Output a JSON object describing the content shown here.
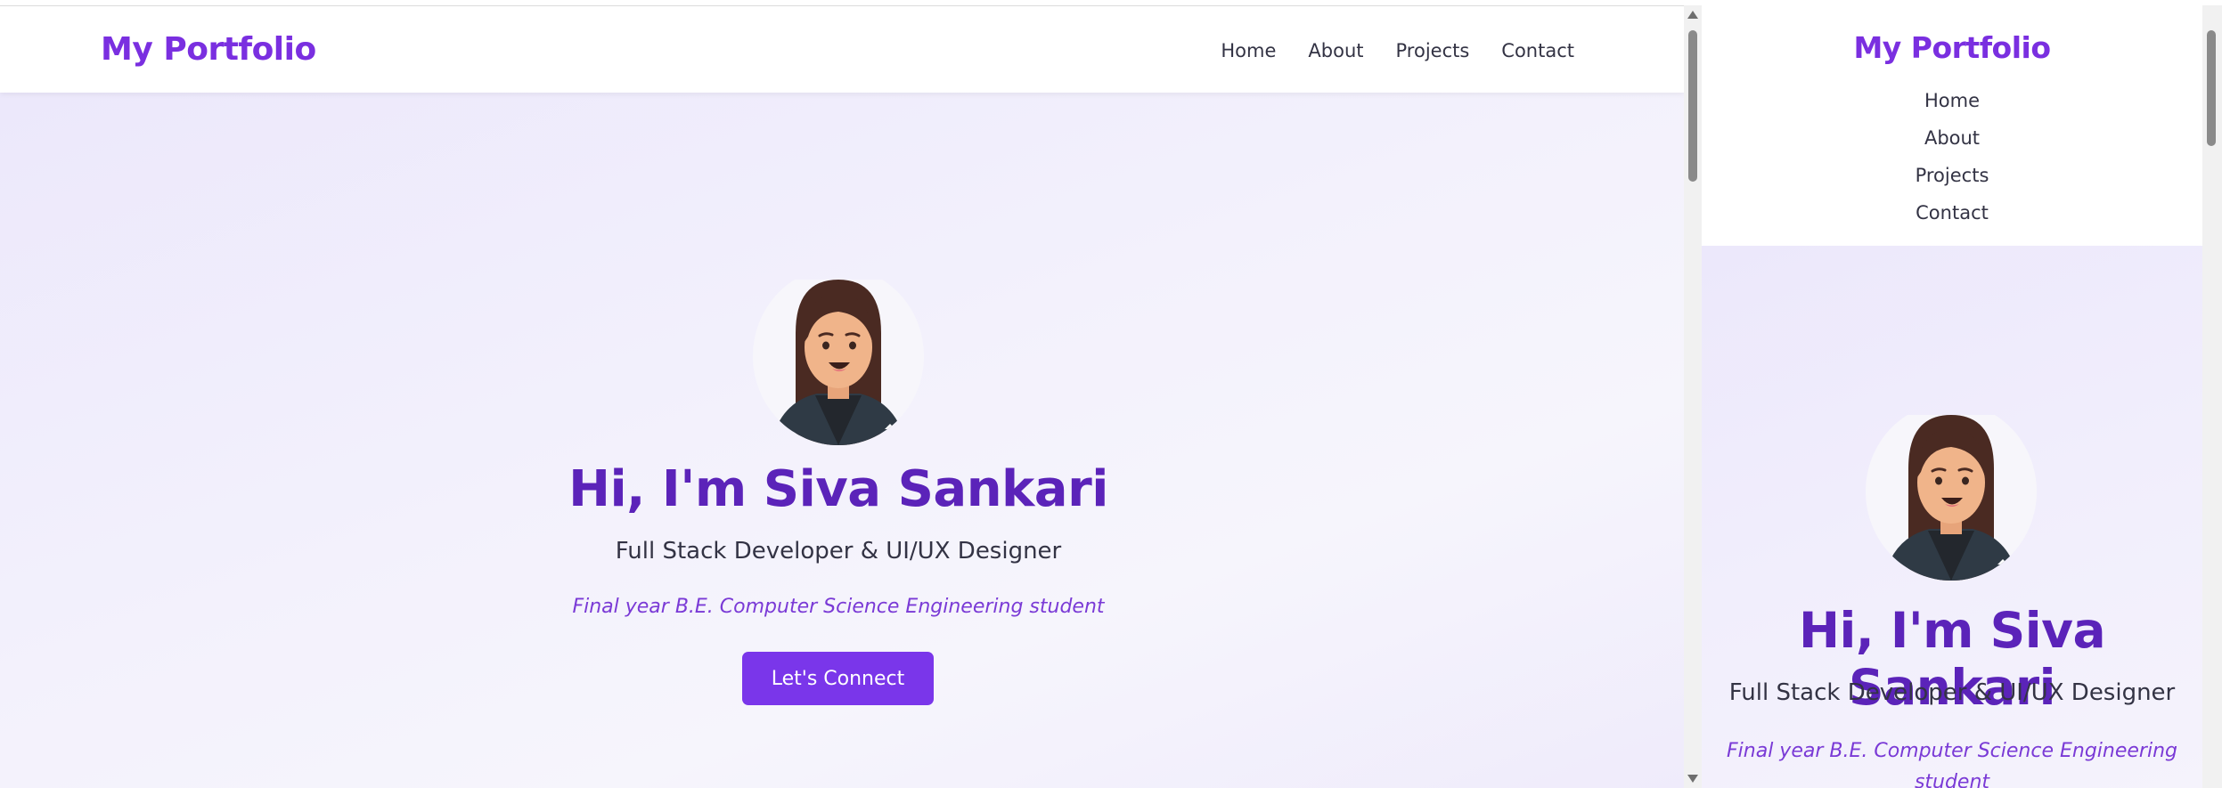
{
  "desktop": {
    "logo": "My Portfolio",
    "nav": [
      {
        "label": "Home"
      },
      {
        "label": "About"
      },
      {
        "label": "Projects"
      },
      {
        "label": "Contact"
      }
    ],
    "hero": {
      "title": "Hi, I'm Siva Sankari",
      "role": "Full Stack Developer & UI/UX Designer",
      "note": "Final year B.E. Computer Science Engineering student",
      "cta_label": "Let's Connect"
    }
  },
  "mobile": {
    "logo": "My Portfolio",
    "nav": [
      {
        "label": "Home"
      },
      {
        "label": "About"
      },
      {
        "label": "Projects"
      },
      {
        "label": "Contact"
      }
    ],
    "hero": {
      "title": "Hi, I'm Siva Sankari",
      "role": "Full Stack Developer & UI/UX Designer",
      "note": "Final year B.E. Computer Science Engineering student"
    }
  },
  "colors": {
    "brand": "#7a2fe0",
    "title": "#5b23b9",
    "cta": "#7a36ea",
    "note": "#7a3ad6"
  },
  "icons": [
    "avatar-illustration",
    "scroll-up-arrow",
    "scroll-down-arrow"
  ]
}
